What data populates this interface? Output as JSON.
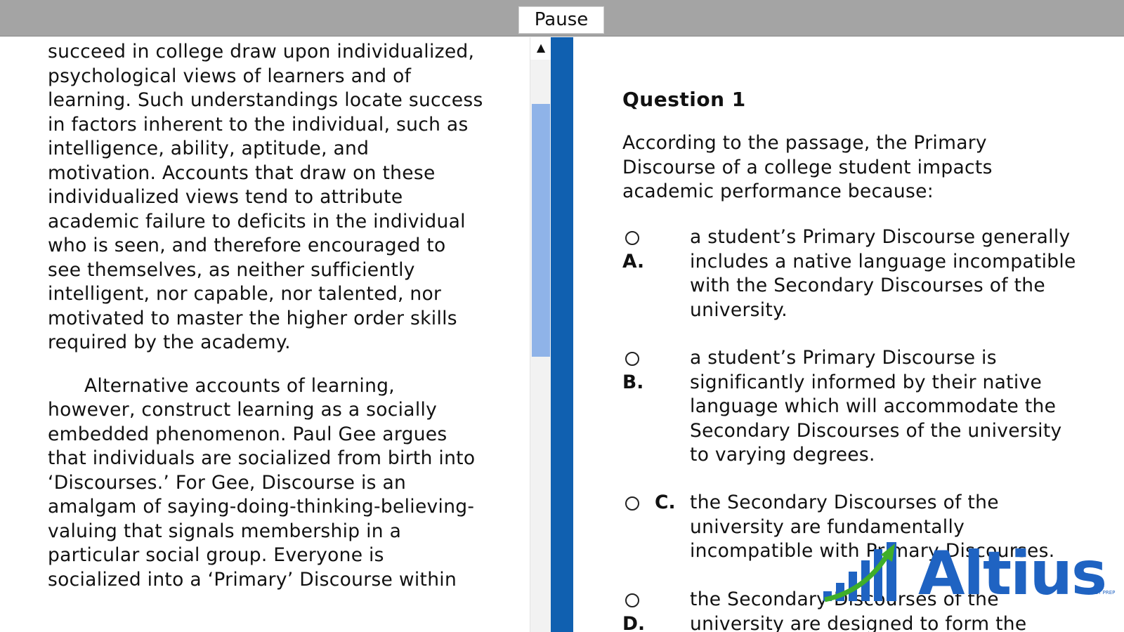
{
  "toolbar": {
    "pause_label": "Pause"
  },
  "passage": {
    "paragraphs": [
      "succeed in college draw upon individualized, psychological views of learners and of learning. Such understandings locate success in factors inherent to the individual, such as intelligence, ability, aptitude, and motivation. Accounts that draw on these individualized views tend to attribute academic failure to deficits in the individual who is seen, and therefore encouraged to see themselves,  as neither sufficiently intelligent, nor capable, nor talented, nor motivated to master the higher order skills required by the academy.",
      "Alternative accounts of learning, however, construct learning as a socially embedded phenomenon. Paul Gee argues that individuals are socialized from birth into ‘Discourses.’ For Gee, Discourse is an amalgam of saying-doing-thinking-believing- valuing that signals membership in a particular social group. Everyone is socialized into a ‘Primary’ Discourse within"
    ]
  },
  "scrollbar": {
    "up_arrow": "▲"
  },
  "question": {
    "title": "Question 1",
    "stem": "According to the passage, the Primary Discourse of a college student impacts academic performance because:",
    "options": [
      {
        "letter": "A.",
        "text": "a student’s Primary Discourse generally includes a native language incompatible with the Secondary Discourses of the university."
      },
      {
        "letter": "B.",
        "text": "a student’s Primary Discourse is significantly informed by their native language which will accommodate the Secondary Discourses of the university to varying degrees."
      },
      {
        "letter": "C.",
        "text": "the Secondary Discourses of the university are fundamentally incompatible with Primary Discourses."
      },
      {
        "letter": "D.",
        "text": "the Secondary Discourses of the university are designed to form the"
      }
    ]
  },
  "logo": {
    "name": "Altius",
    "tagline": "TEST PREP"
  },
  "colors": {
    "accent": "#1060b0",
    "scroll_thumb": "#8fb3e8",
    "toolbar": "#a4a4a4",
    "logo_blue": "#1f63c2",
    "logo_green": "#3fae2a"
  }
}
